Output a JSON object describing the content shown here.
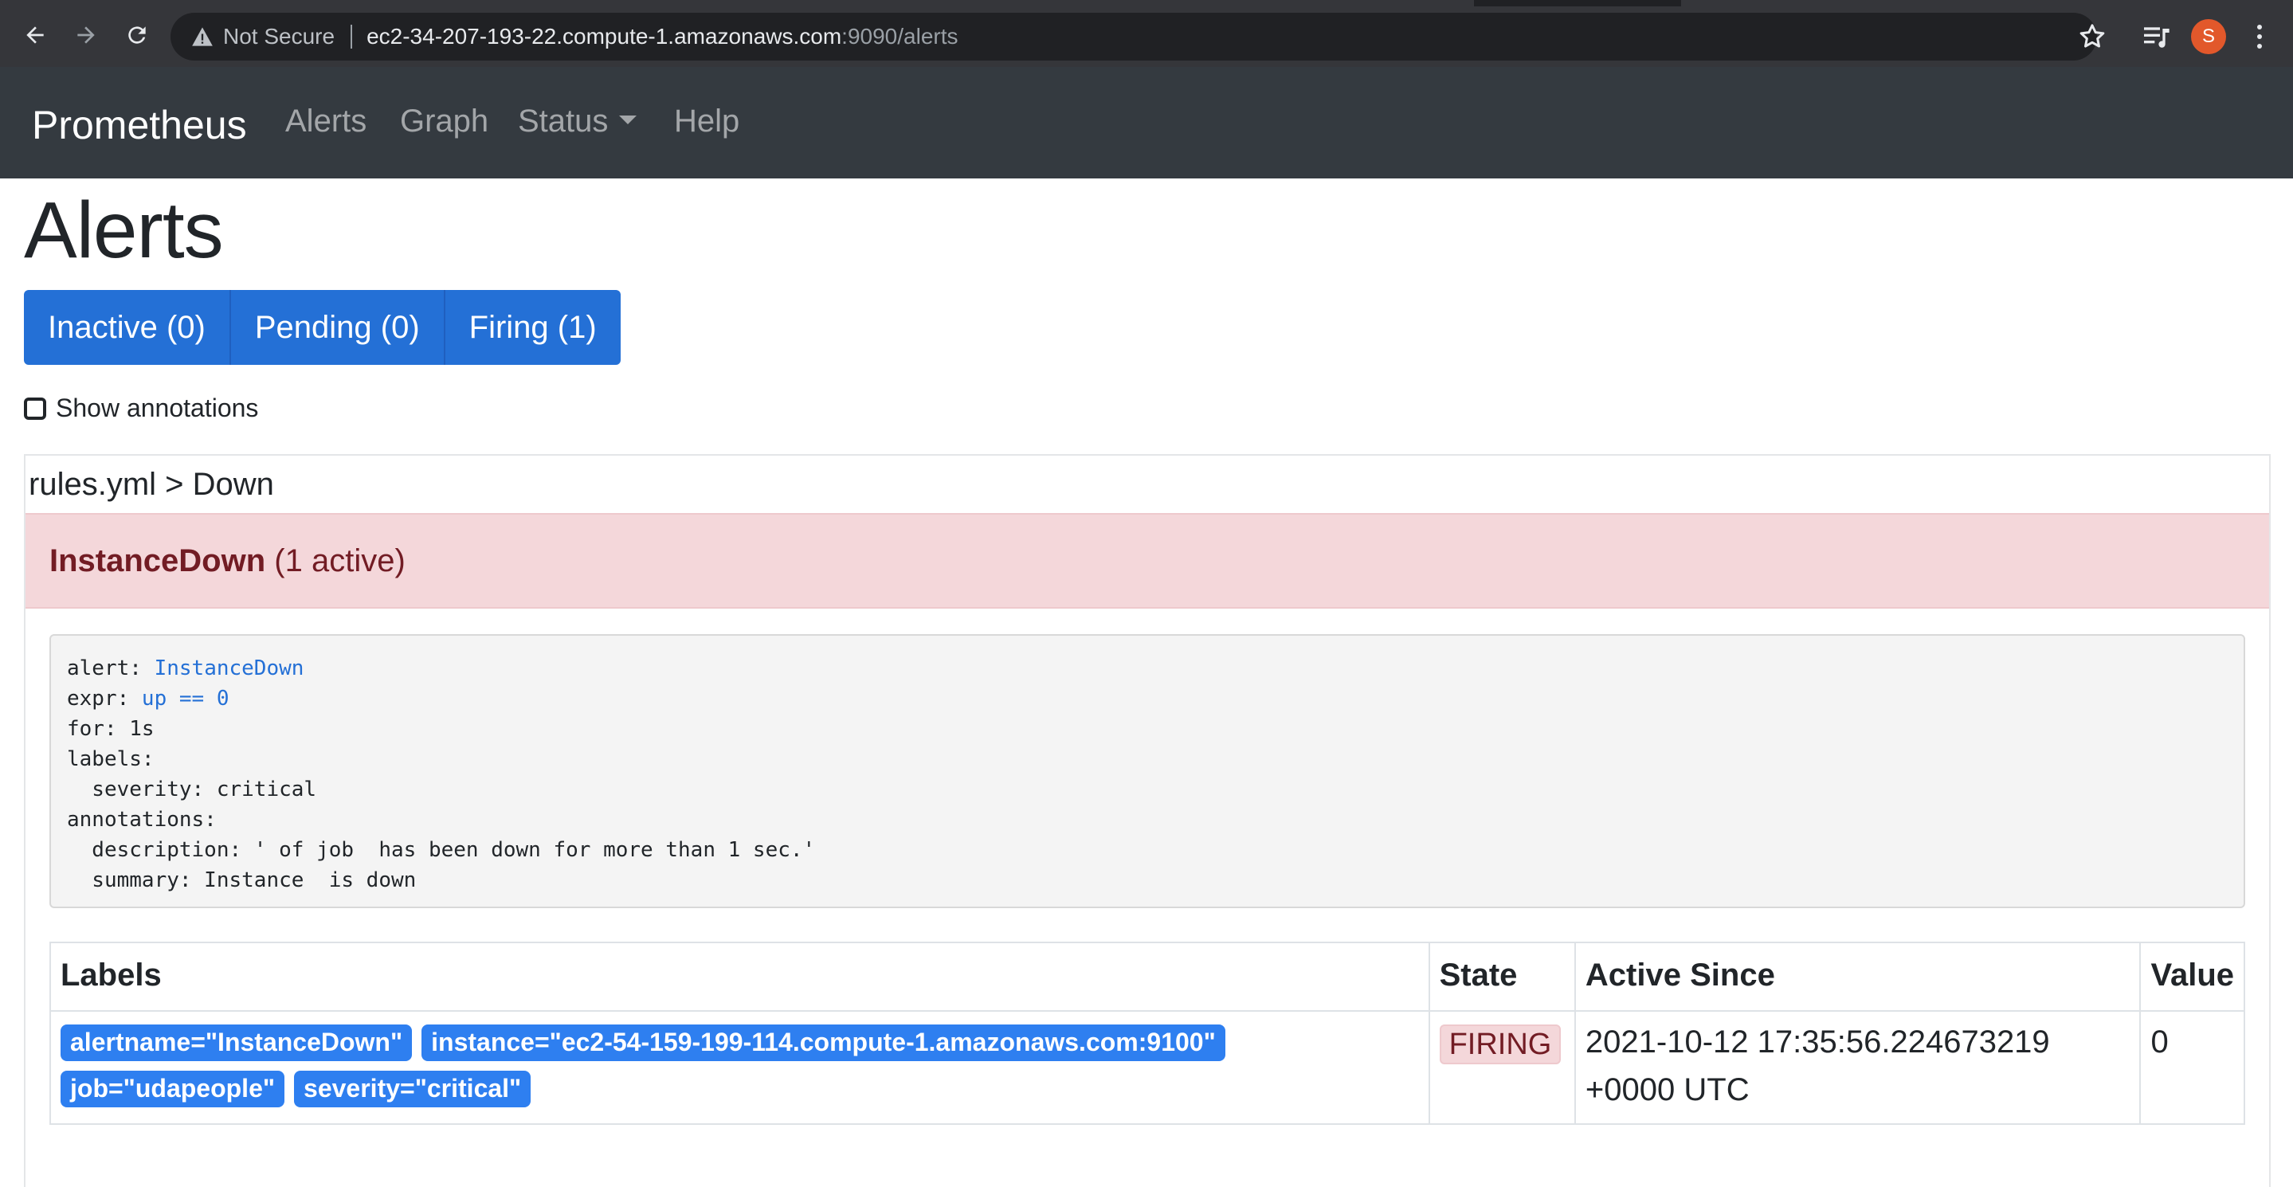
{
  "browser": {
    "security_label": "Not Secure",
    "url_host": "ec2-34-207-193-22.compute-1.amazonaws.com",
    "url_rest": ":9090/alerts",
    "profile_initial": "S",
    "icons": [
      "back-arrow-icon",
      "forward-arrow-icon",
      "reload-icon",
      "warning-icon",
      "star-icon",
      "media-queue-icon",
      "kebab-menu-icon"
    ]
  },
  "navbar": {
    "brand": "Prometheus",
    "links": [
      "Alerts",
      "Graph",
      "Status",
      "Help"
    ]
  },
  "page": {
    "title": "Alerts",
    "filters": [
      "Inactive (0)",
      "Pending (0)",
      "Firing (1)"
    ],
    "show_annotations_label": "Show annotations",
    "show_annotations_checked": false
  },
  "group": {
    "title": "rules.yml > Down",
    "alert_name": "InstanceDown",
    "alert_count": "(1 active)",
    "rule": {
      "alert_key": "alert: ",
      "alert_value": "InstanceDown",
      "expr_key": "expr: ",
      "expr_value": "up == 0",
      "for_line": "for: 1s",
      "labels_line": "labels:",
      "severity_line": "  severity: critical",
      "annotations_line": "annotations:",
      "description_line": "  description: ' of job  has been down for more than 1 sec.'",
      "summary_line": "  summary: Instance  is down"
    }
  },
  "table": {
    "headers": [
      "Labels",
      "State",
      "Active Since",
      "Value"
    ],
    "rows": [
      {
        "labels": [
          "alertname=\"InstanceDown\"",
          "instance=\"ec2-54-159-199-114.compute-1.amazonaws.com:9100\"",
          "job=\"udapeople\"",
          "severity=\"critical\""
        ],
        "state": "FIRING",
        "active_since_line1": "2021-10-12 17:35:56.224673219",
        "active_since_line2": "+0000 UTC",
        "value": "0"
      }
    ]
  },
  "colors": {
    "navbar_bg": "#343a40",
    "primary": "#2470d6",
    "label_badge": "#2e7ff0",
    "danger_bg": "#f4d7da",
    "danger_text": "#721c24"
  }
}
